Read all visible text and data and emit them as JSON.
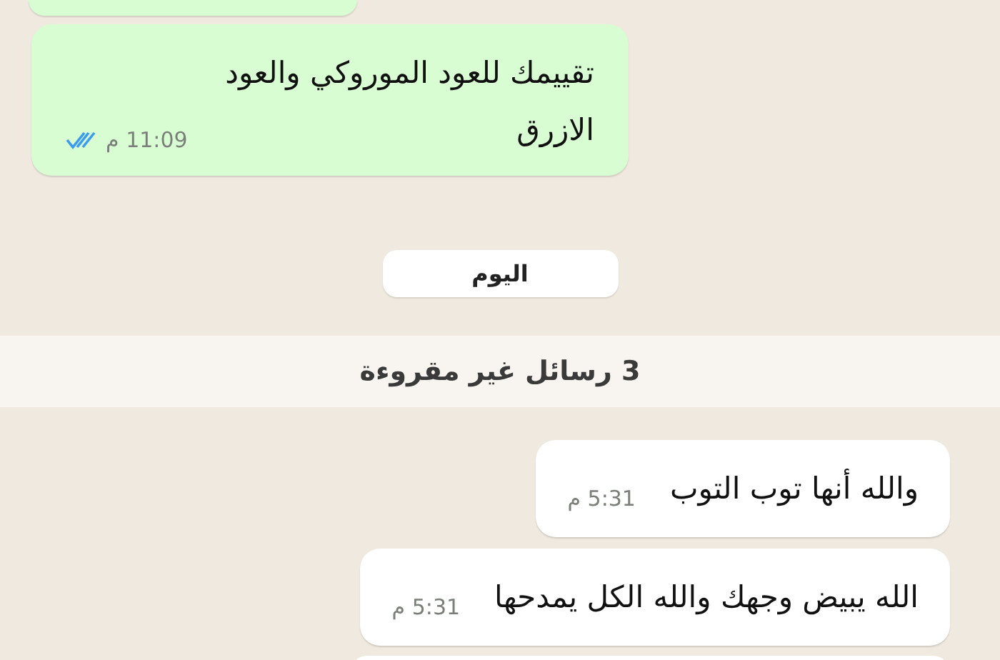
{
  "messages": [
    {
      "kind": "outgoing",
      "text": "تقييمك للعود الموروكي والعود الازرق",
      "time": "11:09 م",
      "read": true
    }
  ],
  "date_chip": "اليوم",
  "unread_banner": "3 رسائل غير مقروءة",
  "new_messages": [
    {
      "kind": "incoming",
      "text": "والله أنها توب التوب",
      "time": "5:31 م"
    },
    {
      "kind": "incoming",
      "text": "الله يبيض وجهك والله الكل يمدحها",
      "time": "5:31 م"
    }
  ]
}
